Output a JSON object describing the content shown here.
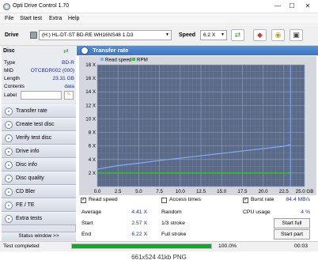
{
  "window": {
    "title": "Opti Drive Control 1.70",
    "minimize": "—",
    "maximize": "☐",
    "close": "✕"
  },
  "menu": [
    "File",
    "Start test",
    "Extra",
    "Help"
  ],
  "drivebar": {
    "drive_label": "Drive",
    "drive_value": "(H:)  HL-DT-ST BD-RE  WH16NS48 1.D3",
    "speed_label": "Speed",
    "speed_value": "6.2 X"
  },
  "disc": {
    "header": "Disc",
    "rows": [
      {
        "label": "Type",
        "value": "BD-R"
      },
      {
        "label": "MID",
        "value": "OTCBDR002 (000)"
      },
      {
        "label": "Length",
        "value": "23.31 GB"
      },
      {
        "label": "Contents",
        "value": "data"
      },
      {
        "label": "Label",
        "value": ""
      }
    ]
  },
  "nav": [
    {
      "label": "Transfer rate",
      "active": true
    },
    {
      "label": "Create test disc",
      "active": false
    },
    {
      "label": "Verify test disc",
      "active": false
    },
    {
      "label": "Drive info",
      "active": false
    },
    {
      "label": "Disc info",
      "active": false
    },
    {
      "label": "Disc quality",
      "active": false
    },
    {
      "label": "CD Bler",
      "active": false
    },
    {
      "label": "FE / TE",
      "active": false
    },
    {
      "label": "Extra tests",
      "active": false
    }
  ],
  "status_window_label": "Status window >>",
  "panel_title": "Transfer rate",
  "chart_data": {
    "type": "line",
    "title": "",
    "legend": [
      "Read speed",
      "RPM"
    ],
    "legend_placement": "top-left",
    "xlabel": "",
    "ylabel": "",
    "x_ticks": [
      "0.0",
      "2.5",
      "5.0",
      "7.5",
      "10.0",
      "12.5",
      "15.0",
      "17.5",
      "20.0",
      "22.5",
      "25.0 GB"
    ],
    "y_ticks": [
      "2 X",
      "4 X",
      "6 X",
      "8 X",
      "10 X",
      "12 X",
      "14 X",
      "16 X",
      "18 X"
    ],
    "xlim": [
      0,
      25
    ],
    "ylim": [
      0,
      18
    ],
    "grid": true,
    "series": [
      {
        "name": "Read speed",
        "color": "#7fb0ff",
        "x": [
          0,
          2.5,
          5,
          7.5,
          10,
          12.5,
          15,
          17.5,
          20,
          22.5,
          23.3
        ],
        "y": [
          2.57,
          3.1,
          3.45,
          3.85,
          4.2,
          4.55,
          4.9,
          5.25,
          5.6,
          5.95,
          6.22
        ]
      },
      {
        "name": "RPM",
        "color": "#2ad02a",
        "x": [
          0,
          23.3
        ],
        "y": [
          2.0,
          2.0
        ]
      }
    ],
    "burst_line": {
      "x": 23.3,
      "color": "#7fb0ff"
    }
  },
  "checks": {
    "read_speed": {
      "label": "Read speed",
      "checked": true
    },
    "access_times": {
      "label": "Access times",
      "checked": false
    },
    "burst_rate": {
      "label": "Burst rate",
      "checked": true,
      "value": "84.4 MB/s"
    }
  },
  "stats": {
    "average_label": "Average",
    "average": "4.41 X",
    "start_label": "Start",
    "start": "2.57 X",
    "end_label": "End",
    "end": "6.22 X",
    "random_label": "Random",
    "stroke13_label": "1/3 stroke",
    "full_label": "Full stroke",
    "cpu_label": "CPU usage",
    "cpu": "4 %"
  },
  "buttons": {
    "start_full": "Start full",
    "start_part": "Start part"
  },
  "statusbar": {
    "text": "Test completed",
    "progress_text": "100.0%",
    "progress": 1.0,
    "time": "00:03"
  },
  "footer": "661x524  41kb  PNG",
  "colors": {
    "accent": "#3e74bd",
    "chart_bg": "#5b6a87",
    "grid": "#8ea0c0",
    "progress": "#06b025"
  }
}
